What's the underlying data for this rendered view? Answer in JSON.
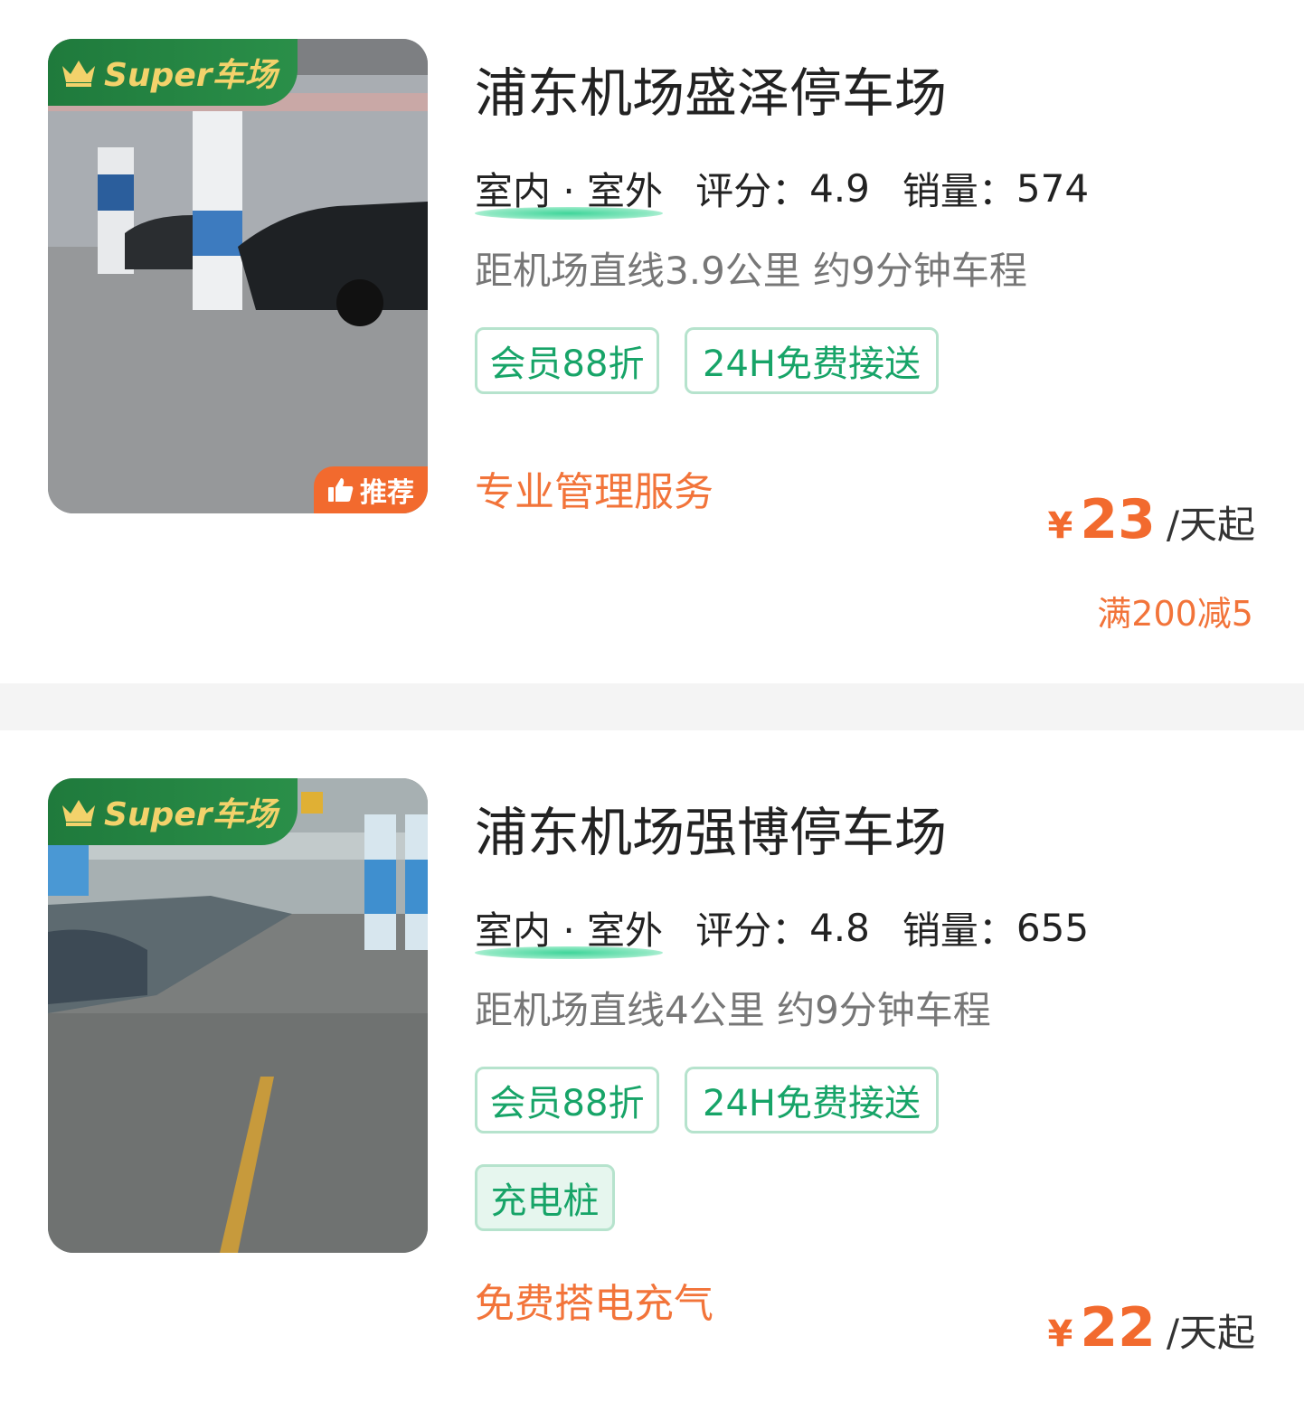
{
  "listings": [
    {
      "badge": "Super车场",
      "recommend": "推荐",
      "name": "浦东机场盛泽停车场",
      "type": "室内 · 室外",
      "rating_label": "评分：",
      "rating": "4.9",
      "sales_label": "销量：",
      "sales": "574",
      "distance": "距机场直线3.9公里 约9分钟车程",
      "tags": [
        "会员88折",
        "24H免费接送"
      ],
      "slogan": "专业管理服务",
      "currency": "¥",
      "price": "23",
      "unit": "/天起",
      "promo": "满200减5"
    },
    {
      "badge": "Super车场",
      "name": "浦东机场强博停车场",
      "type": "室内 · 室外",
      "rating_label": "评分：",
      "rating": "4.8",
      "sales_label": "销量：",
      "sales": "655",
      "distance": "距机场直线4公里 约9分钟车程",
      "tags": [
        "会员88折",
        "24H免费接送",
        "充电桩"
      ],
      "slogan": "免费搭电充气",
      "currency": "¥",
      "price": "22",
      "unit": "/天起"
    }
  ],
  "colors": {
    "accent_green": "#17a468",
    "accent_orange": "#f26a2e",
    "badge_green": "#1f7a3c"
  }
}
